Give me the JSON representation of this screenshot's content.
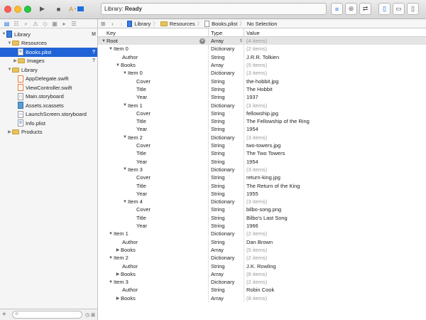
{
  "toolbar": {
    "activity_prefix": "Library: ",
    "activity_status": "Ready"
  },
  "navigator": {
    "items": [
      {
        "label": "Library",
        "badge": "M"
      },
      {
        "label": "Resources",
        "badge": ""
      },
      {
        "label": "Books.plist",
        "badge": "?"
      },
      {
        "label": "Images",
        "badge": "?"
      },
      {
        "label": "Library",
        "badge": ""
      },
      {
        "label": "AppDelegate.swift",
        "badge": ""
      },
      {
        "label": "ViewController.swift",
        "badge": ""
      },
      {
        "label": "Main.storyboard",
        "badge": ""
      },
      {
        "label": "Assets.xcassets",
        "badge": ""
      },
      {
        "label": "LaunchScreen.storyboard",
        "badge": ""
      },
      {
        "label": "Info.plist",
        "badge": ""
      },
      {
        "label": "Products",
        "badge": ""
      }
    ]
  },
  "jumpbar": {
    "crumbs": [
      "Library",
      "Resources",
      "Books.plist",
      "No Selection"
    ]
  },
  "plist": {
    "headers": {
      "key": "Key",
      "type": "Type",
      "value": "Value"
    },
    "rows": [
      {
        "key": "Root",
        "type": "Array",
        "value": "(4 items)"
      },
      {
        "key": "Item 0",
        "type": "Dictionary",
        "value": "(2 items)"
      },
      {
        "key": "Author",
        "type": "String",
        "value": "J.R.R. Tolkien"
      },
      {
        "key": "Books",
        "type": "Array",
        "value": "(5 items)"
      },
      {
        "key": "Item 0",
        "type": "Dictionary",
        "value": "(3 items)"
      },
      {
        "key": "Cover",
        "type": "String",
        "value": "the-hobbit.jpg"
      },
      {
        "key": "Title",
        "type": "String",
        "value": "The Hobbit"
      },
      {
        "key": "Year",
        "type": "String",
        "value": "1937"
      },
      {
        "key": "Item 1",
        "type": "Dictionary",
        "value": "(3 items)"
      },
      {
        "key": "Cover",
        "type": "String",
        "value": "fellowship.jpg"
      },
      {
        "key": "Title",
        "type": "String",
        "value": "The Fellowship of the Ring"
      },
      {
        "key": "Year",
        "type": "String",
        "value": "1954"
      },
      {
        "key": "Item 2",
        "type": "Dictionary",
        "value": "(3 items)"
      },
      {
        "key": "Cover",
        "type": "String",
        "value": "two-towers.jpg"
      },
      {
        "key": "Title",
        "type": "String",
        "value": "The Two Towers"
      },
      {
        "key": "Year",
        "type": "String",
        "value": "1954"
      },
      {
        "key": "Item 3",
        "type": "Dictionary",
        "value": "(3 items)"
      },
      {
        "key": "Cover",
        "type": "String",
        "value": "return-king.jpg"
      },
      {
        "key": "Title",
        "type": "String",
        "value": "The Return of the King"
      },
      {
        "key": "Year",
        "type": "String",
        "value": "1955"
      },
      {
        "key": "Item 4",
        "type": "Dictionary",
        "value": "(3 items)"
      },
      {
        "key": "Cover",
        "type": "String",
        "value": "bilbo-song.png"
      },
      {
        "key": "Title",
        "type": "String",
        "value": "Bilbo's Last Song"
      },
      {
        "key": "Year",
        "type": "String",
        "value": "1966"
      },
      {
        "key": "Item 1",
        "type": "Dictionary",
        "value": "(2 items)"
      },
      {
        "key": "Author",
        "type": "String",
        "value": "Dan Brown"
      },
      {
        "key": "Books",
        "type": "Array",
        "value": "(5 items)"
      },
      {
        "key": "Item 2",
        "type": "Dictionary",
        "value": "(2 items)"
      },
      {
        "key": "Author",
        "type": "String",
        "value": "J.K. Rowling"
      },
      {
        "key": "Books",
        "type": "Array",
        "value": "(8 items)"
      },
      {
        "key": "Item 3",
        "type": "Dictionary",
        "value": "(2 items)"
      },
      {
        "key": "Author",
        "type": "String",
        "value": "Robin Cook"
      },
      {
        "key": "Books",
        "type": "Array",
        "value": "(8 items)"
      }
    ]
  },
  "colors": {
    "selection": "#1f63d6",
    "folder": "#e6c35c",
    "accent": "#1d6fe0"
  }
}
